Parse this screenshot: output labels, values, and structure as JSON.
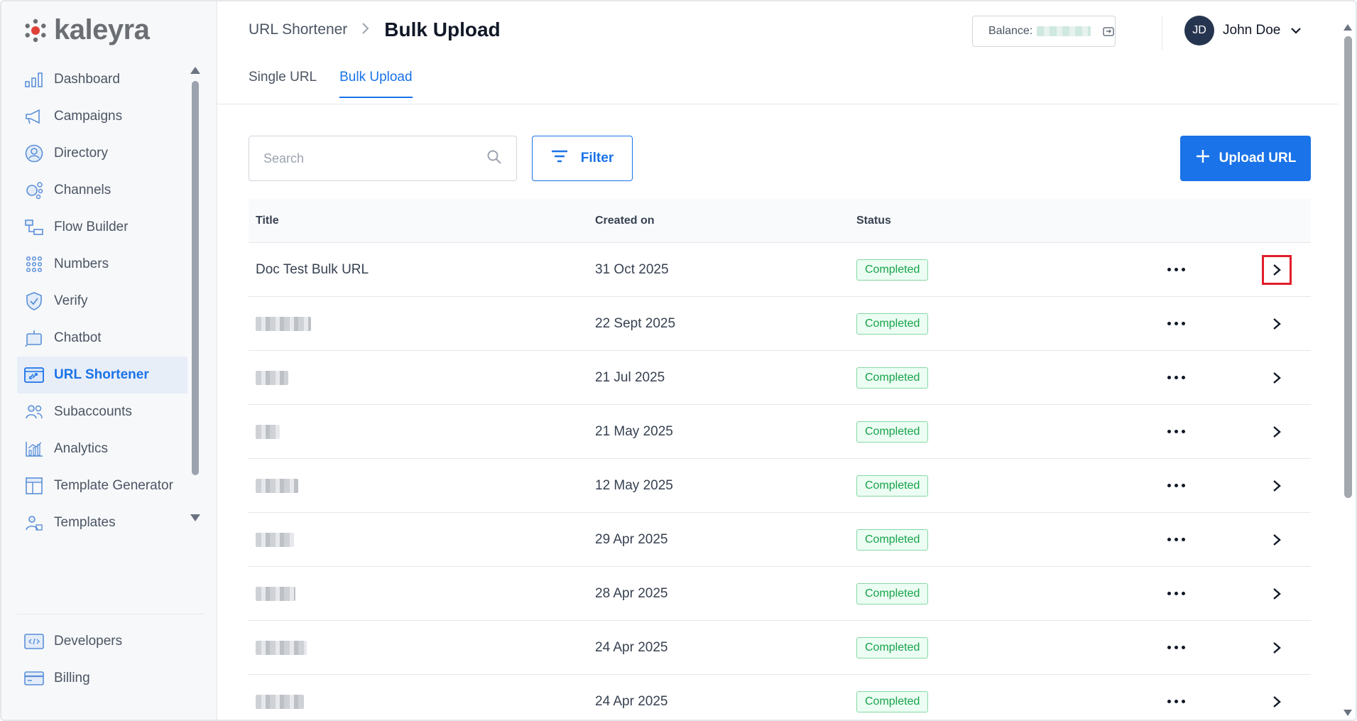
{
  "brand": {
    "name": "kaleyra"
  },
  "sidebar": {
    "items": [
      {
        "label": "Dashboard",
        "icon": "bar-chart-icon"
      },
      {
        "label": "Campaigns",
        "icon": "megaphone-icon"
      },
      {
        "label": "Directory",
        "icon": "user-circle-icon"
      },
      {
        "label": "Channels",
        "icon": "channels-icon"
      },
      {
        "label": "Flow Builder",
        "icon": "flow-icon"
      },
      {
        "label": "Numbers",
        "icon": "dial-grid-icon"
      },
      {
        "label": "Verify",
        "icon": "shield-check-icon"
      },
      {
        "label": "Chatbot",
        "icon": "robot-icon"
      },
      {
        "label": "URL Shortener",
        "icon": "link-icon",
        "active": true
      },
      {
        "label": "Subaccounts",
        "icon": "users-icon"
      },
      {
        "label": "Analytics",
        "icon": "analytics-icon"
      },
      {
        "label": "Template Generator",
        "icon": "layout-icon"
      },
      {
        "label": "Templates",
        "icon": "templates-icon"
      }
    ],
    "bottom_items": [
      {
        "label": "Developers",
        "icon": "code-icon"
      },
      {
        "label": "Billing",
        "icon": "card-icon"
      }
    ]
  },
  "header": {
    "breadcrumb_parent": "URL Shortener",
    "breadcrumb_current": "Bulk Upload",
    "balance_label": "Balance:",
    "user_initials": "JD",
    "user_name": "John Doe"
  },
  "tabs": [
    {
      "label": "Single URL",
      "active": false
    },
    {
      "label": "Bulk Upload",
      "active": true
    }
  ],
  "toolbar": {
    "search_placeholder": "Search",
    "filter_label": "Filter",
    "upload_label": "Upload URL"
  },
  "table": {
    "columns": [
      "Title",
      "Created on",
      "Status"
    ],
    "rows": [
      {
        "title": "Doc Test Bulk URL",
        "created_on": "31 Oct 2025",
        "status": "Completed",
        "title_blurred": false,
        "highlight": true
      },
      {
        "title": "",
        "created_on": "22 Sept 2025",
        "status": "Completed",
        "title_blurred": true
      },
      {
        "title": "",
        "created_on": "21 Jul 2025",
        "status": "Completed",
        "title_blurred": true
      },
      {
        "title": "",
        "created_on": "21 May 2025",
        "status": "Completed",
        "title_blurred": true
      },
      {
        "title": "",
        "created_on": "12 May 2025",
        "status": "Completed",
        "title_blurred": true
      },
      {
        "title": "",
        "created_on": "29 Apr 2025",
        "status": "Completed",
        "title_blurred": true
      },
      {
        "title": "",
        "created_on": "28 Apr 2025",
        "status": "Completed",
        "title_blurred": true
      },
      {
        "title": "",
        "created_on": "24 Apr 2025",
        "status": "Completed",
        "title_blurred": true
      },
      {
        "title": "",
        "created_on": "24 Apr 2025",
        "status": "Completed",
        "title_blurred": true
      }
    ]
  },
  "colors": {
    "accent": "#1a73e8",
    "success": "#16a34a",
    "highlight": "#e11d2a",
    "avatar": "#26354f"
  }
}
